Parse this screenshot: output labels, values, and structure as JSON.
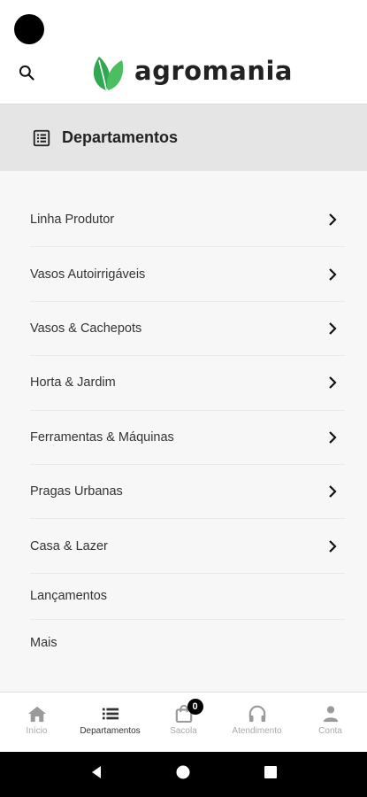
{
  "brand": {
    "name": "agromania",
    "leaf_color": "#2fa84f"
  },
  "header": {
    "search_icon": "search-icon"
  },
  "departments": {
    "title": "Departamentos",
    "icon": "list-box-icon"
  },
  "menu": {
    "items": [
      {
        "label": "Linha Produtor",
        "has_chevron": true
      },
      {
        "label": "Vasos Autoirrigáveis",
        "has_chevron": true
      },
      {
        "label": "Vasos & Cachepots",
        "has_chevron": true
      },
      {
        "label": "Horta & Jardim",
        "has_chevron": true
      },
      {
        "label": "Ferramentas & Máquinas",
        "has_chevron": true
      },
      {
        "label": "Pragas Urbanas",
        "has_chevron": true
      },
      {
        "label": "Casa & Lazer",
        "has_chevron": true
      },
      {
        "label": "Lançamentos",
        "has_chevron": false
      },
      {
        "label": "Mais",
        "has_chevron": false
      }
    ]
  },
  "bottom_nav": {
    "items": [
      {
        "label": "Início",
        "icon": "home-icon",
        "active": false
      },
      {
        "label": "Departamentos",
        "icon": "list-icon",
        "active": true
      },
      {
        "label": "Sacola",
        "icon": "bag-icon",
        "active": false,
        "badge": "0"
      },
      {
        "label": "Atendimento",
        "icon": "headphones-icon",
        "active": false
      },
      {
        "label": "Conta",
        "icon": "person-icon",
        "active": false
      }
    ]
  },
  "system_nav": {
    "back": "back-icon",
    "home": "home-circle-icon",
    "recents": "recents-icon"
  }
}
